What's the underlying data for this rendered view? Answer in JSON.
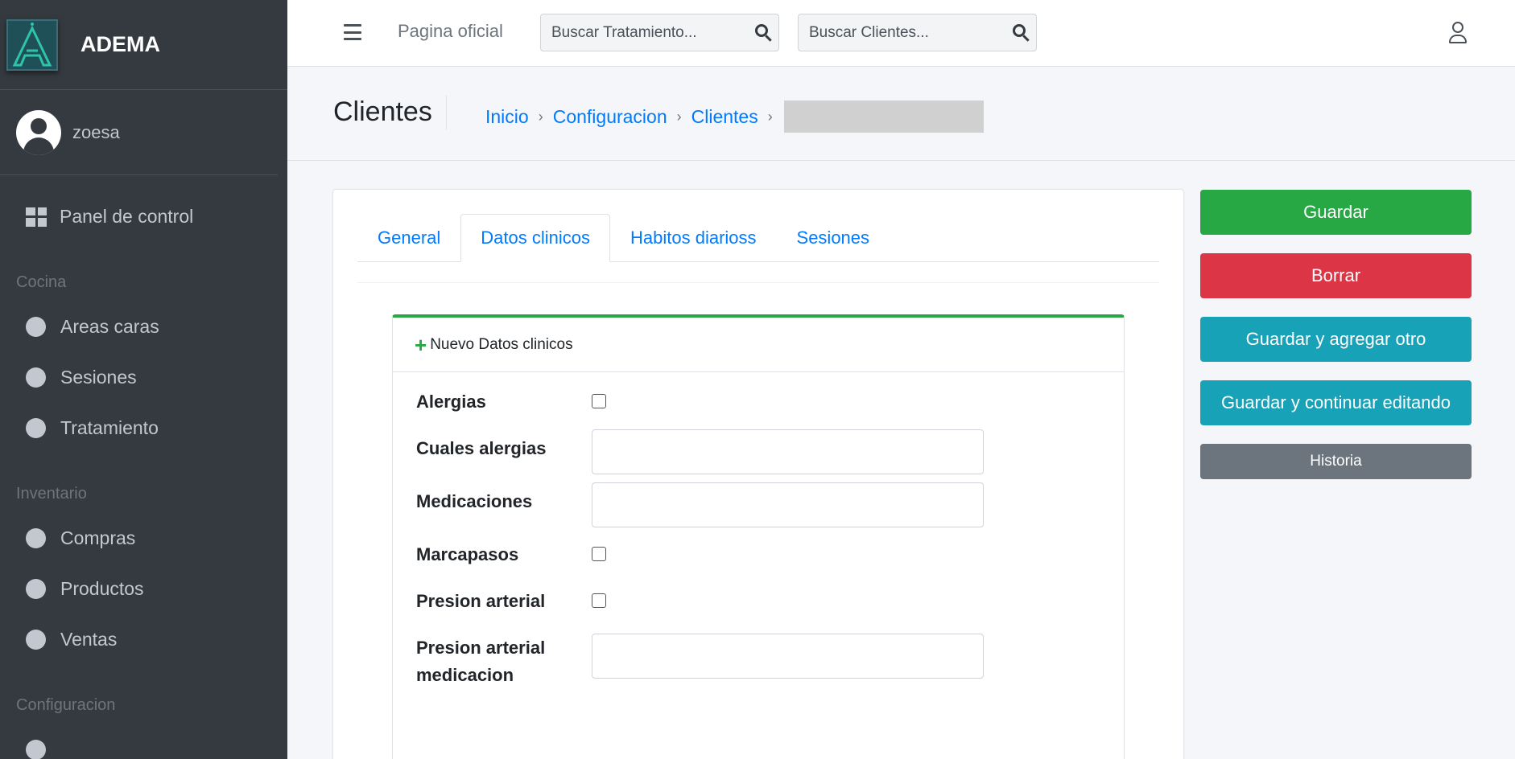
{
  "brand": {
    "name": "ADEMA",
    "logo_letter": "A"
  },
  "user": {
    "name": "zoesa"
  },
  "sidebar": {
    "panel": "Panel de control",
    "sections": [
      {
        "header": "Cocina",
        "items": [
          "Areas caras",
          "Sesiones",
          "Tratamiento"
        ]
      },
      {
        "header": "Inventario",
        "items": [
          "Compras",
          "Productos",
          "Ventas"
        ]
      },
      {
        "header": "Configuracion",
        "items": []
      }
    ]
  },
  "topbar": {
    "pagina": "Pagina oficial",
    "search_tratamiento_placeholder": "Buscar Tratamiento...",
    "search_clientes_placeholder": "Buscar Clientes..."
  },
  "header": {
    "title": "Clientes",
    "breadcrumb": [
      "Inicio",
      "Configuracion",
      "Clientes"
    ],
    "separator": "›"
  },
  "tabs": [
    "General",
    "Datos clinicos",
    "Habitos diarioss",
    "Sesiones"
  ],
  "active_tab": "Datos clinicos",
  "form": {
    "new_label": "Nuevo Datos clinicos",
    "fields": {
      "alergias": "Alergias",
      "cuales_alergias": "Cuales alergias",
      "medicaciones": "Medicaciones",
      "marcapasos": "Marcapasos",
      "presion_arterial": "Presion arterial",
      "presion_arterial_medicacion": "Presion arterial medicacion"
    }
  },
  "actions": {
    "save": "Guardar",
    "delete": "Borrar",
    "save_add": "Guardar y agregar otro",
    "save_continue": "Guardar y continuar editando",
    "history": "Historia"
  },
  "colors": {
    "sidebar": "#343a40",
    "primary": "#007bff",
    "success": "#28a745",
    "danger": "#dc3545",
    "info": "#17a2b8",
    "secondary": "#6c757d"
  }
}
